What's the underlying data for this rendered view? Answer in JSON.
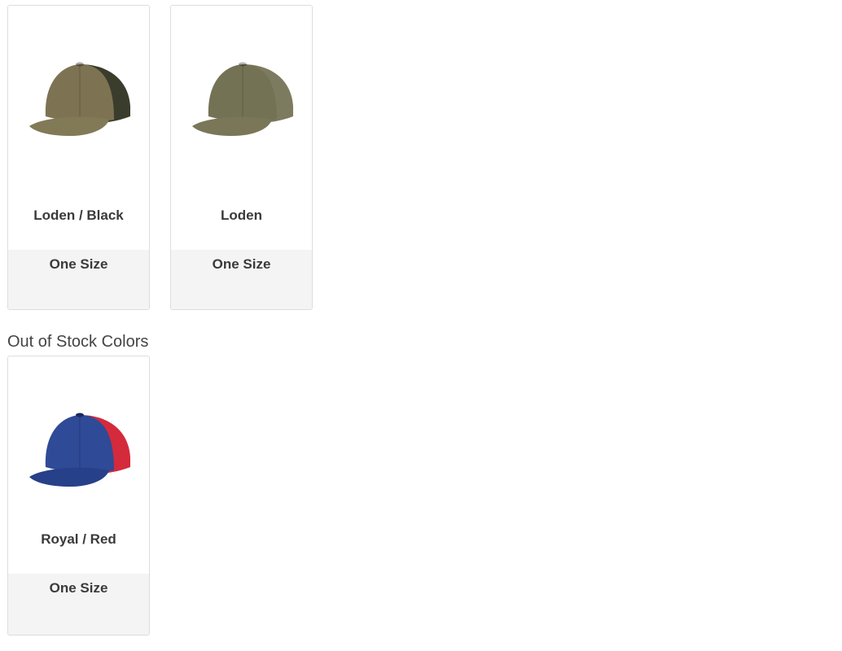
{
  "in_stock": [
    {
      "color_name": "Loden / Black",
      "size": "One Size",
      "crown_color": "#7d7353",
      "mesh_color": "#3a3d2c",
      "bill_color": "#827a57"
    },
    {
      "color_name": "Loden",
      "size": "One Size",
      "crown_color": "#747255",
      "mesh_color": "#7d7b5f",
      "bill_color": "#7a7658"
    }
  ],
  "out_of_stock_heading": "Out of Stock Colors",
  "out_of_stock": [
    {
      "color_name": "Royal / Red",
      "size": "One Size",
      "crown_color": "#2f4a97",
      "mesh_color": "#d42a3c",
      "bill_color": "#27408a"
    }
  ]
}
